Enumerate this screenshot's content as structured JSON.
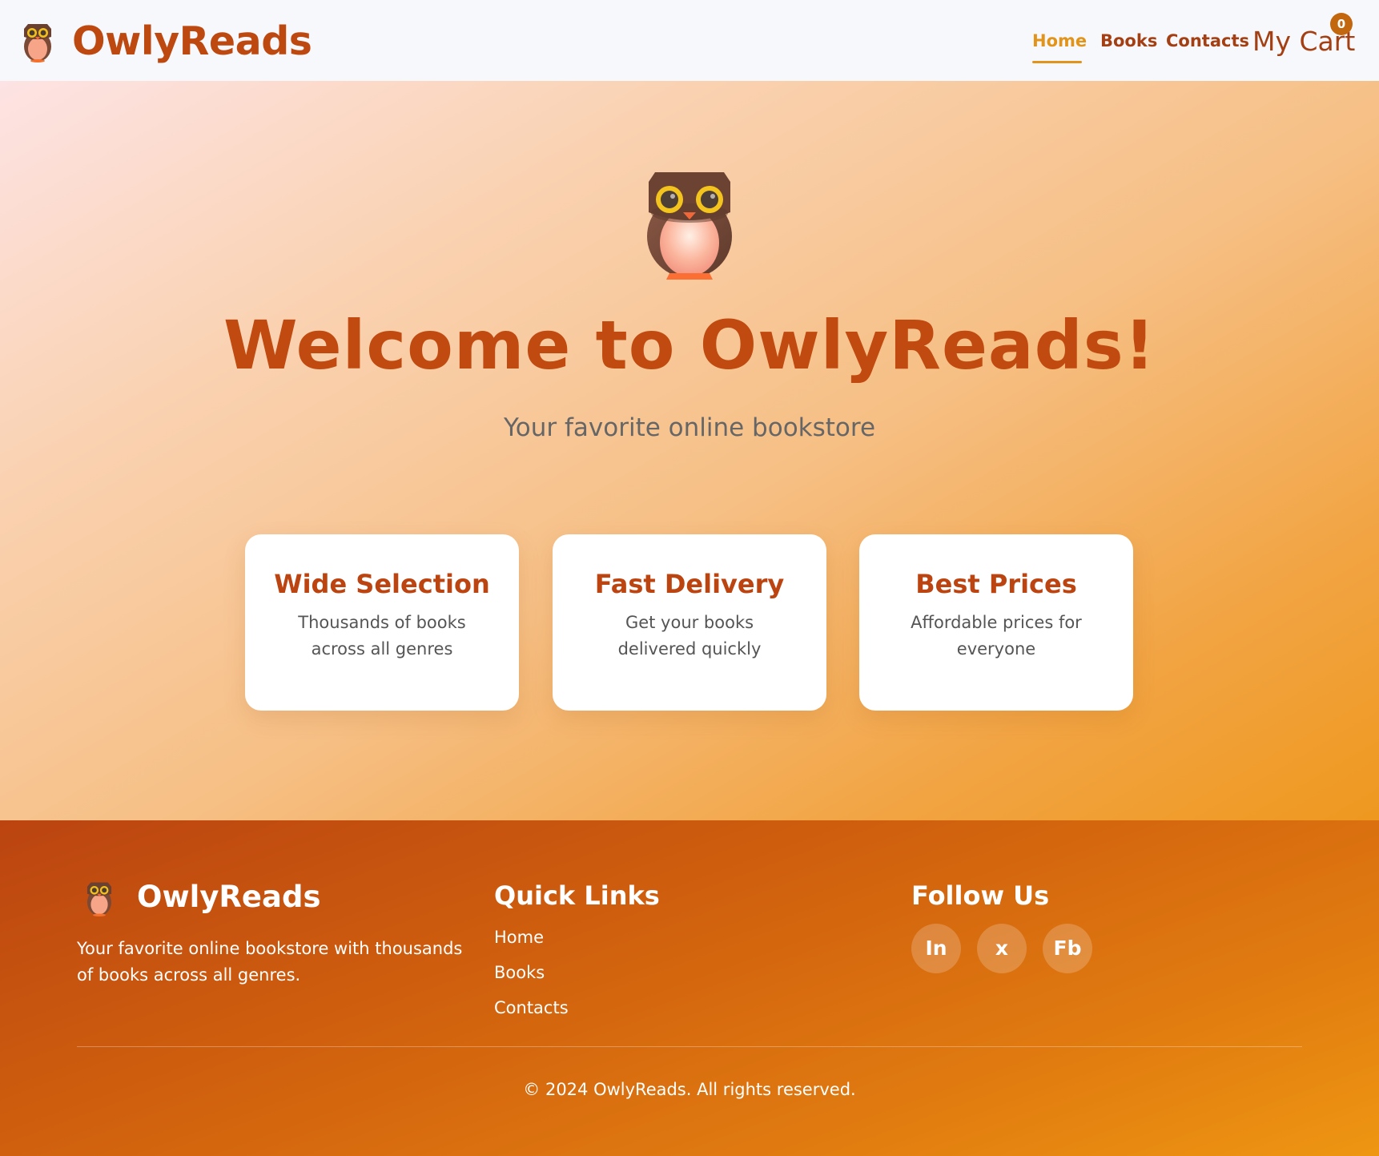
{
  "header": {
    "brand": "OwlyReads",
    "logo_icon": "owl-icon",
    "nav": [
      {
        "label": "Home",
        "active": true
      },
      {
        "label": "Books",
        "active": false
      },
      {
        "label": "Contacts",
        "active": false
      }
    ],
    "cart_label": "My Cart",
    "cart_count": "0"
  },
  "hero": {
    "icon": "owl-icon",
    "title": "Welcome to OwlyReads!",
    "subtitle": "Your favorite online bookstore",
    "features": [
      {
        "title": "Wide Selection",
        "text": "Thousands of books across all genres"
      },
      {
        "title": "Fast Delivery",
        "text": "Get your books delivered quickly"
      },
      {
        "title": "Best Prices",
        "text": "Affordable prices for everyone"
      }
    ]
  },
  "footer": {
    "brand": "OwlyReads",
    "description": "Your favorite online bookstore with thousands of books across all genres.",
    "quick_links_heading": "Quick Links",
    "quick_links": [
      "Home",
      "Books",
      "Contacts"
    ],
    "follow_heading": "Follow Us",
    "social": [
      "In",
      "x",
      "Fb"
    ],
    "copyright": "© 2024 OwlyReads. All rights reserved."
  },
  "colors": {
    "brand": "#bd4810",
    "accent": "#e2931a",
    "nav_text": "#a33f12",
    "card_bg": "#ffffff",
    "footer_start": "#bb4410",
    "footer_end": "#ee9612"
  }
}
